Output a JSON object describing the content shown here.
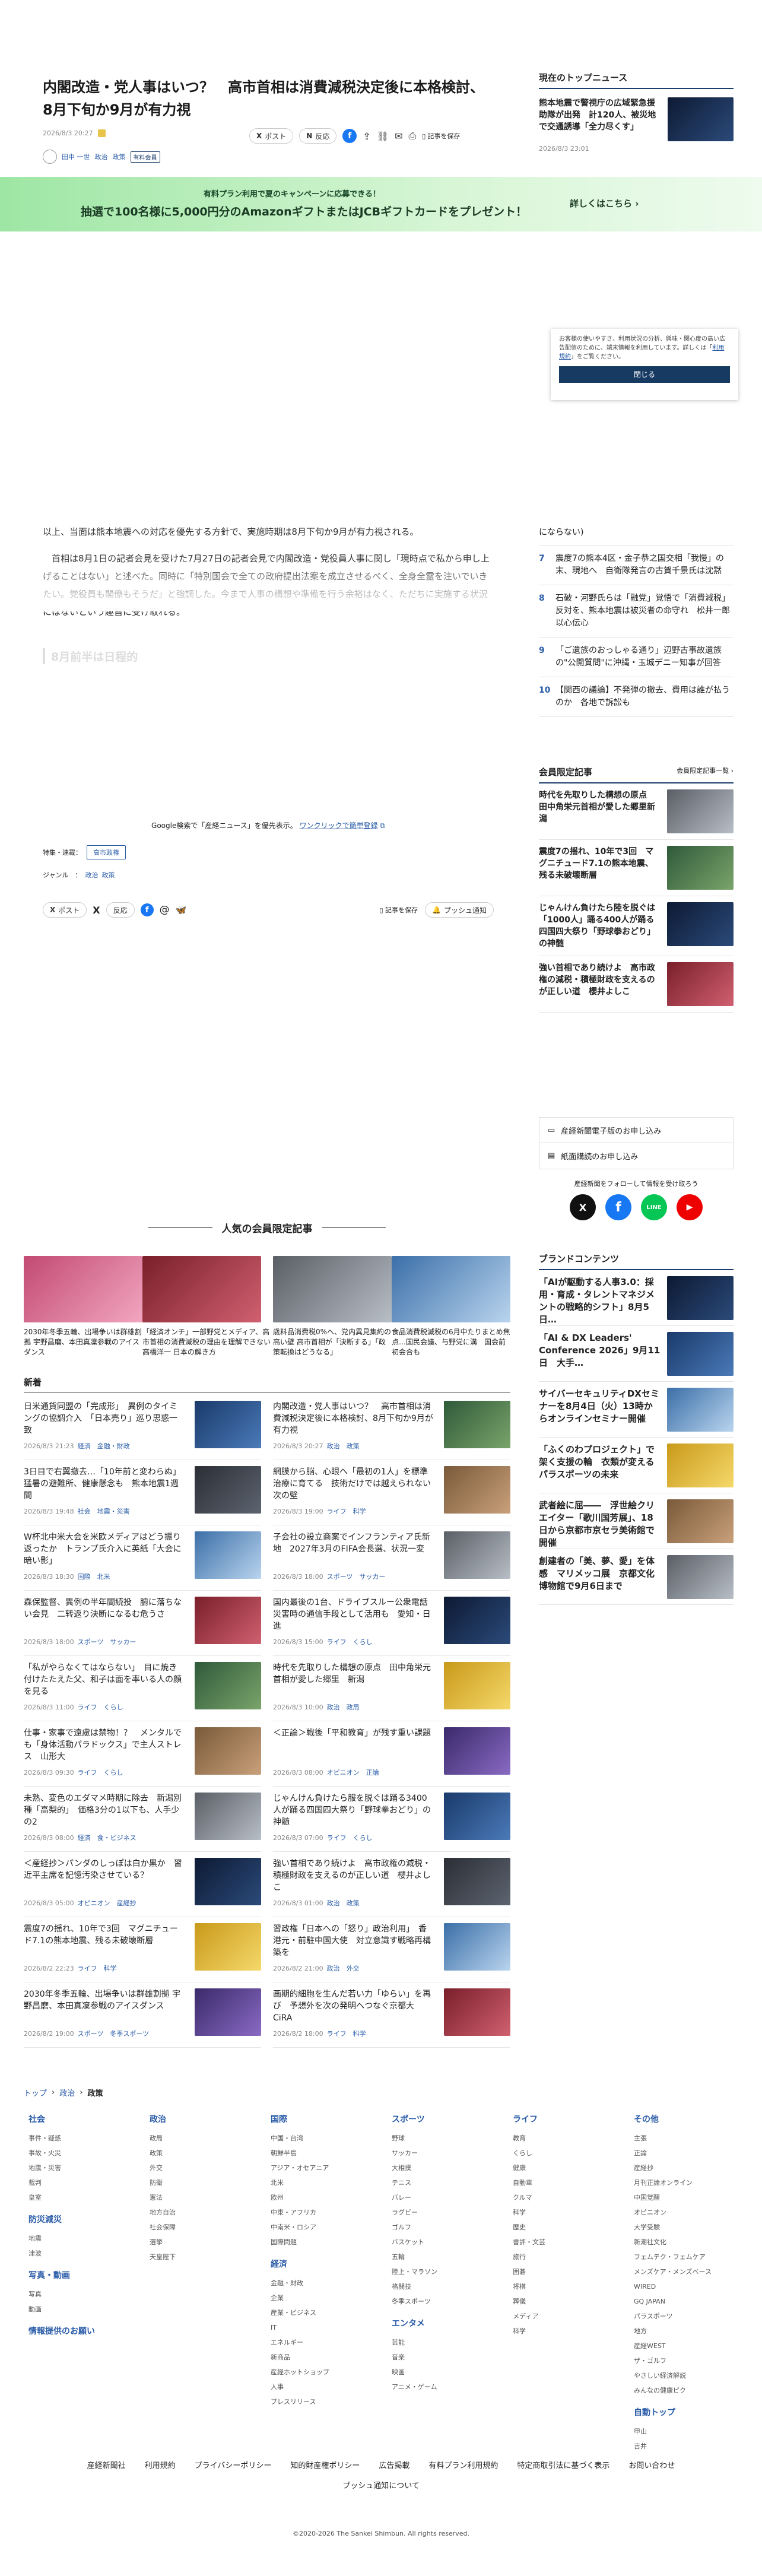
{
  "article": {
    "title": "内閣改造・党人事はいつ？　高市首相は消費減税決定後に本格検討、8月下旬か9月が有力視",
    "date": "2026/8/3 20:27",
    "author": "田中 一世",
    "tags": [
      "政治",
      "政策"
    ],
    "premium_badge": "有料会員",
    "share_post": "ポスト",
    "share_repost": "反応",
    "save_label": "記事を保存",
    "body_1": "以上、当面は熊本地震への対応を優先する方針で、実施時期は8月下旬か9月が有力視される。",
    "body_2": "首相は8月1日の記者会見を受けた7月27日の記者会見で内閣改造・党役員人事に関し「現時点で私から申し上げることはない」と述べた。同時に「特別国会で全ての政府提出法案を成立させるべく、全身全霊を注いでいきたい。党役員も閣僚もそうだ」と強調した。今まで人事の構想や準備を行う余裕はなく、ただちに実施する状況にはないという趣旨に受け取れる。",
    "subhead": "8月前半は日程的",
    "google_text": "Google検索で「産経ニュース」を優先表示。",
    "google_link": "ワンクリックで簡単登録",
    "topic_label": "特集・連載：",
    "topic_value": "高市政権",
    "genre_label": "ジャンル　：",
    "genre_values": [
      "政治",
      "政策"
    ],
    "push_label": "プッシュ通知"
  },
  "banner": {
    "sub": "有料プラン利用で夏のキャンペーンに応募できる！",
    "main": "抽選で100名様に5,000円分のAmazonギフトまたはJCBギフトカードをプレゼント！",
    "cta": "詳しくはこちら"
  },
  "consent": {
    "text": "お客様の使いやすさ、利用状況の分析、興味・関心度の高い広告配信のために、端末情報を利用しています。詳しくは「",
    "link": "利用規約",
    "text2": "」をご覧ください。",
    "button": "閉じる"
  },
  "sidebar": {
    "top_title": "現在のトップニュース",
    "top_headline": "熊本地震で警視庁の広域緊急援助隊が出発　計120人、被災地で交通誘導「全力尽くす」",
    "top_date": "2026/8/3 23:01",
    "rank_partial": "にならない)",
    "ranking": [
      {
        "n": "7",
        "t": "震度7の熊本4区・金子恭之国交相「我慢」の末、現地へ　自衛隊発言の古賀千景氏は沈黙"
      },
      {
        "n": "8",
        "t": "石破・河野氏らは「融党」覚悟で「消費減税」反対を、熊本地震は被災者の命守れ　松井一郎　以心伝心"
      },
      {
        "n": "9",
        "t": "「ご遺族のおっしゃる通り」辺野古事故遺族の\"公開質問\"に沖縄・玉城デニー知事が回答"
      },
      {
        "n": "10",
        "t": "【関西の議論】不発弾の撤去、費用は誰が払うのか　各地で訴訟も"
      }
    ],
    "members_title": "会員限定記事",
    "members_more": "会員限定記事一覧",
    "members": [
      "時代を先取りした構想の原点　田中角栄元首相が愛した郷里新潟",
      "震度7の揺れ、10年で3回　マグニチュード7.1の熊本地震、残る未破壊断層",
      "じゃんけん負けたら陸を脱ぐは「1000人」踊る400人が踊る四国四大祭り「野球拳おどり」の神髄",
      "強い首相であり続けよ　高市政権の減税・積極財政を支えるのが正しい道　櫻井よしこ"
    ],
    "links": [
      "産経新聞電子版のお申し込み",
      "紙面購読のお申し込み"
    ],
    "follow_label": "産経新聞をフォローして情報を受け取ろう",
    "brand_title": "ブランドコンテンツ",
    "brand": [
      "「AIが駆動する人事3.0：採用・育成・タレントマネジメントの戦略的シフト」8月5日…",
      "「AI & DX Leaders' Conference 2026」9月11日　大手…",
      "サイバーセキュリティDXセミナーを8月4日（火）13時からオンラインセミナー開催",
      "「ふくのわプロジェクト」で架く支援の輪　衣類が変えるパラスポーツの未来",
      "武者絵に屈――　浮世絵クリエイター「歌川国芳展」、18日から京都市京セラ美術館で開催",
      "創建者の「美、夢、愛」を体感　マリメッコ展　京都文化博物館で9月6日まで"
    ]
  },
  "popular": {
    "title": "人気の会員限定記事",
    "items": [
      "2030年冬季五輪、出場争いは群雄割拠 宇野昌磨、本田真凜参戦のアイスダンス",
      "「経済オンチ」一部野党とメディア、高市首相の消費減税の理由を理解できない 高橋洋一 日本の解き方",
      "歳料品消費税0%へ、党内異見集約の高い壁 高市首相が「決断する」「政策転換はどうなる」",
      "食品消費税減税の6月中たりまとめ焦点…国民会議、与野党に溝　国会前初会合も"
    ]
  },
  "latest": {
    "title": "新着",
    "left": [
      {
        "h": "日米通貨同盟の「完成形」　異例のタイミングの協調介入　「日本売り」巡り思惑一致",
        "d": "2026/8/3 21:23",
        "t": "経済　金融・財政"
      },
      {
        "h": "3日目で右翼撤去…「10年前と変わらぬ」猛暑の避難所、健康懸念も　熊本地震1週間",
        "d": "2026/8/3 19:48",
        "t": "社会　地震・災害"
      },
      {
        "h": "W杯北中米大会を米欧メディアはどう振り返ったか　トランプ氏介入に英紙「大会に暗い影」",
        "d": "2026/8/3 18:30",
        "t": "国際　北米"
      },
      {
        "h": "森保監督、異例の半年間続投　腑に落ちない会見　二转返り決断になるむ危うさ",
        "d": "2026/8/3 18:00",
        "t": "スポーツ　サッカー"
      },
      {
        "h": "「私がやらなくてはならない」　目に焼き付けたたえた父、和子は面を率いる人の顔を見る",
        "d": "2026/8/3 11:00",
        "t": "ライフ　くらし"
      },
      {
        "h": "仕事・家事で遠慮は禁物！？　メンタルでも「身体活動パラドックス」で主人ストレス　山形大",
        "d": "2026/8/3 09:30",
        "t": "ライフ　くらし"
      },
      {
        "h": "未熟、変色のエダマメ時期に除去　新潟別種「高梨的」　価格3分の1以下も、人手少の2",
        "d": "2026/8/3 08:00",
        "t": "経済　食・ビジネス"
      },
      {
        "h": "＜産経抄＞パンダのしっぽは白か黒か　習近平主席を記憶汚染させている？",
        "d": "2026/8/3 05:00",
        "t": "オピニオン　産経抄"
      },
      {
        "h": "震度7の揺れ、10年で3回　マグニチュード7.1の熊本地震、残る未破壊断層",
        "d": "2026/8/2 22:23",
        "t": "ライフ　科学"
      },
      {
        "h": "2030年冬季五輪、出場争いは群雄割拠 宇野昌磨、本田真凜参戦のアイスダンス",
        "d": "2026/8/2 19:00",
        "t": "スポーツ　冬季スポーツ"
      }
    ],
    "right": [
      {
        "h": "内閣改造・党人事はいつ？　高市首相は消費減税決定後に本格検討、8月下旬か9月が有力視",
        "d": "2026/8/3 20:27",
        "t": "政治　政策"
      },
      {
        "h": "網膜から脳、心眼へ「最初の1人」を標準治療に育てる　技術だけでは越えられない次の壁",
        "d": "2026/8/3 19:00",
        "t": "ライフ　科学"
      },
      {
        "h": "子会社の設立商案でインフランティア氏新地　2027年3月のFIFA会長選、状況一変",
        "d": "2026/8/3 18:00",
        "t": "スポーツ　サッカー"
      },
      {
        "h": "国内最後の1台、ドライブスルー公衆電話　災害時の通信手段として活用も　愛知・日進",
        "d": "2026/8/3 15:00",
        "t": "ライフ　くらし"
      },
      {
        "h": "時代を先取りした構想の原点　田中角栄元首相が愛した郷里　新潟",
        "d": "2026/8/3 10:00",
        "t": "政治　政局"
      },
      {
        "h": "＜正論＞戦後「平和教育」が残す重い課題",
        "d": "2026/8/3 08:00",
        "t": "オピニオン　正論"
      },
      {
        "h": "じゃんけん負けたら服を脱ぐは踊る3400人が踊る四国四大祭り「野球拳おどり」の神髄",
        "d": "2026/8/3 07:00",
        "t": "ライフ　くらし"
      },
      {
        "h": "強い首相であり続けよ　高市政権の減税・積極財政を支えるのが正しい道　櫻井よしこ",
        "d": "2026/8/3 01:00",
        "t": "政治　政策"
      },
      {
        "h": "習政権「日本への「怒り」政治利用」　香港元・前駐中国大使　対立意識す戦略再構築を",
        "d": "2026/8/2 21:00",
        "t": "政治　外交"
      },
      {
        "h": "画期的細胞を生んだ若い力「ゆらい」を再び　予想外を次の発明へつなぐ京都大CiRA",
        "d": "2026/8/2 18:00",
        "t": "ライフ　科学"
      }
    ]
  },
  "breadcrumb": [
    "トップ",
    "政治",
    "政策"
  ],
  "footer_cols": [
    {
      "h": "社会",
      "items": [
        "事件・疑惑",
        "事故・火災",
        "地震・災害",
        "裁判",
        "皇室"
      ],
      "h2": "防災減災",
      "items2": [
        "地震",
        "津波"
      ],
      "h3": "写真・動画",
      "items3": [
        "写真",
        "動画"
      ],
      "h4": "情報提供のお願い"
    },
    {
      "h": "政治",
      "items": [
        "政局",
        "政策",
        "外交",
        "防衛",
        "憲法",
        "地方自治",
        "社会保障",
        "選挙",
        "天皇陛下"
      ]
    },
    {
      "h": "国際",
      "items": [
        "中国・台湾",
        "朝鮮半島",
        "アジア・オセアニア",
        "北米",
        "欧州",
        "中東・アフリカ",
        "中南米・ロシア",
        "国際問題"
      ],
      "h2": "経済",
      "items2": [
        "金融・財政",
        "企業",
        "産業・ビジネス",
        "IT",
        "エネルギー",
        "新商品",
        "産経ホットショップ",
        "人事",
        "プレスリリース"
      ]
    },
    {
      "h": "スポーツ",
      "items": [
        "野球",
        "サッカー",
        "大相撲",
        "テニス",
        "バレー",
        "ラグビー",
        "ゴルフ",
        "バスケット",
        "五輪",
        "陸上・マラソン",
        "格闘技",
        "冬季スポーツ"
      ],
      "h2": "エンタメ",
      "items2": [
        "芸能",
        "音楽",
        "映画",
        "アニメ・ゲーム"
      ]
    },
    {
      "h": "ライフ",
      "items": [
        "教育",
        "くらし",
        "健康",
        "自動車",
        "クルマ",
        "科学",
        "歴史",
        "書評・文芸",
        "旅行",
        "囲碁",
        "将棋",
        "葬儀",
        "メディア",
        "科学"
      ]
    },
    {
      "h": "その他",
      "items": [
        "主張",
        "正論",
        "産経抄",
        "月刊正論オンライン",
        "中国覚醒",
        "オピニオン",
        "大学受験",
        "新潮社文化",
        "フェムテク・フェムケア",
        "メンズケア・メンズベース",
        "WIRED",
        "GQ JAPAN",
        "パラスポーツ",
        "地方",
        "産経WEST",
        "ザ・ゴルフ",
        "やさしい経済解説",
        "みんなの健康ピク"
      ],
      "h2": "自動トップ",
      "items2": [
        "甲山",
        "吉井"
      ]
    }
  ],
  "footer_links": [
    "産経新聞社",
    "利用規約",
    "プライバシーポリシー",
    "知的財産権ポリシー",
    "広告掲載",
    "有料プラン利用規約",
    "特定商取引法に基づく表示",
    "お問い合わせ",
    "プッシュ通知について"
  ],
  "copyright": "©2020-2026 The Sankei Shimbun. All rights reserved."
}
